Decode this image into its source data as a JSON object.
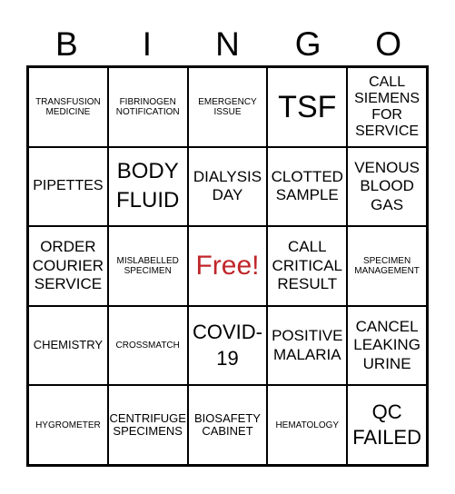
{
  "header": [
    "B",
    "I",
    "N",
    "G",
    "O"
  ],
  "free_color": "#c0262a",
  "cells": [
    "TRANSFUSION MEDICINE",
    "FIBRINOGEN NOTIFICATION",
    "EMERGENCY ISSUE",
    "TSF",
    "CALL SIEMENS FOR SERVICE",
    "PIPETTES",
    "BODY FLUID",
    "DIALYSIS DAY",
    "CLOTTED SAMPLE",
    "VENOUS BLOOD GAS",
    "ORDER COURIER SERVICE",
    "MISLABELLED SPECIMEN",
    "Free!",
    "CALL CRITICAL RESULT",
    "SPECIMEN MANAGEMENT",
    "CHEMISTRY",
    "CROSSMATCH",
    "COVID-19",
    "POSITIVE MALARIA",
    "CANCEL LEAKING URINE",
    "HYGROMETER",
    "CENTRIFUGE SPECIMENS",
    "BIOSAFETY CABINET",
    "HEMATOLOGY",
    "QC FAILED"
  ]
}
